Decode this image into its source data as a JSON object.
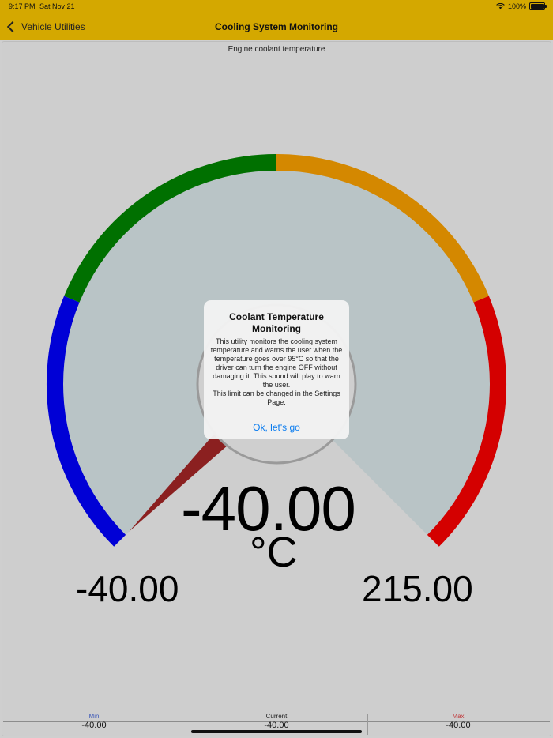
{
  "status_bar": {
    "time": "9:17 PM",
    "date": "Sat Nov 21",
    "battery": "100%",
    "wifi_icon": "wifi-icon",
    "battery_icon": "battery-icon"
  },
  "nav": {
    "back_label": "Vehicle Utilities",
    "title": "Cooling System Monitoring",
    "back_icon": "chevron-left-icon"
  },
  "gauge": {
    "caption": "Engine coolant temperature",
    "value": "-40.00",
    "unit": "°C",
    "min_label": "-40.00",
    "max_label": "215.00",
    "min": -40,
    "max": 215,
    "current": -40,
    "colors": {
      "band_low": "#0000d6",
      "band_normal": "#007000",
      "band_warm": "#d48800",
      "band_hot": "#d40000",
      "dial_face": "#b9c4c6",
      "needle": "#8b2020"
    }
  },
  "stats": {
    "min_label": "Min",
    "min_value": "-40.00",
    "min_color": "#3a56b8",
    "current_label": "Current",
    "current_value": "-40.00",
    "max_label": "Max",
    "max_value": "-40.00",
    "max_color": "#c0393b"
  },
  "alert": {
    "title": "Coolant Temperature Monitoring",
    "message": "This utility monitors the cooling system temperature and warns the user when the temperature goes over 95°C so that the driver can turn the engine OFF without damaging it. This sound will play to warn the user.\nThis limit can be changed in the Settings Page.",
    "button_label": "Ok, let's go"
  }
}
